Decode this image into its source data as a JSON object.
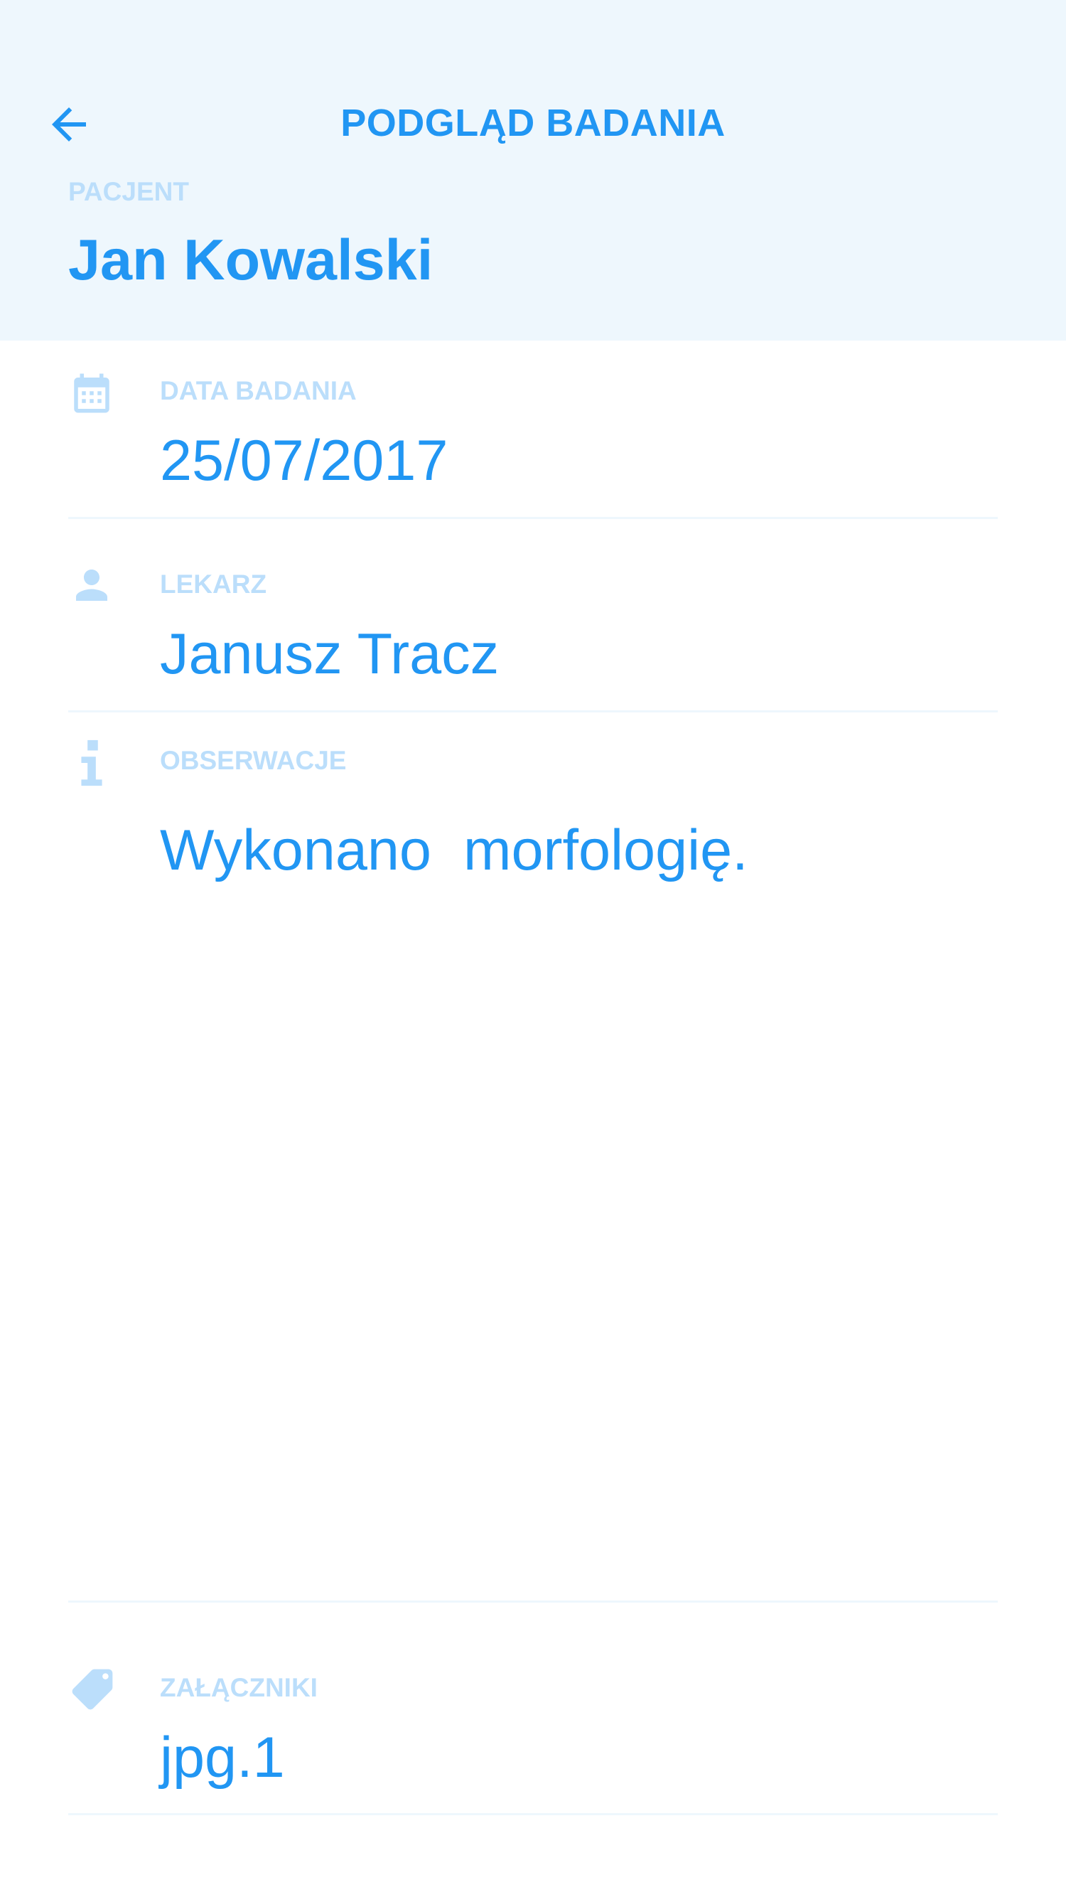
{
  "header": {
    "title": "PODGLĄD BADANIA",
    "patient_label": "PACJENT",
    "patient_name": "Jan Kowalski",
    "back_icon": "arrow-left-icon"
  },
  "fields": {
    "date": {
      "icon": "calendar-icon",
      "label": "DATA BADANIA",
      "value": "25/07/2017"
    },
    "doctor": {
      "icon": "person-icon",
      "label": "LEKARZ",
      "value": "Janusz Tracz"
    },
    "observations": {
      "icon": "info-icon",
      "label": "OBSERWACJE",
      "value": "Wykonano  morfologię."
    },
    "attachments": {
      "icon": "tag-icon",
      "label": "ZAŁĄCZNIKI",
      "value": "jpg.1"
    }
  },
  "colors": {
    "accent": "#2196f3",
    "label": "#bbdefb",
    "header_bg": "#eef7fd"
  }
}
